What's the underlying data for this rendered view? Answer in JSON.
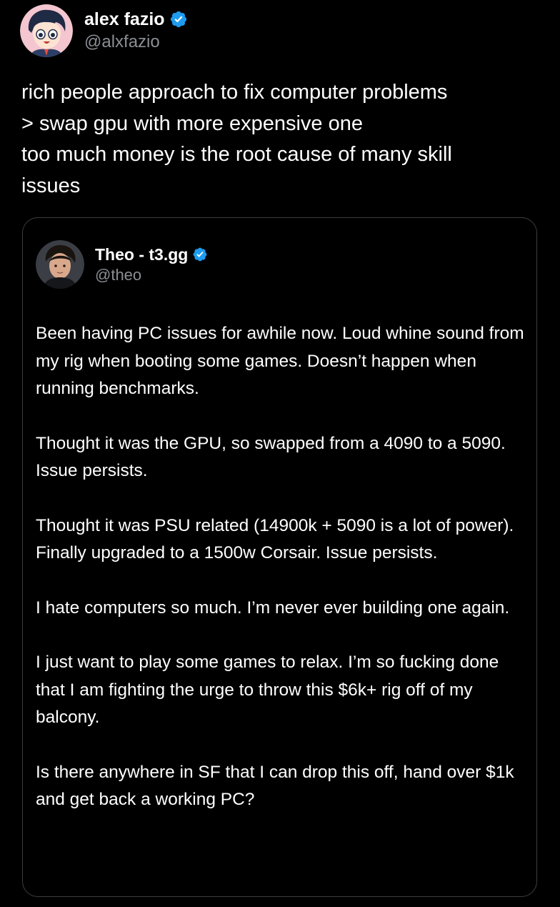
{
  "main_tweet": {
    "author": {
      "display_name": "alex fazio",
      "handle": "@alxfazio",
      "verified": true,
      "avatar_icon": "cartoon-avatar-icon"
    },
    "text": "rich people approach to fix computer problems\n> swap gpu with more expensive one\ntoo much money is the root cause of many skill\nissues"
  },
  "quoted_tweet": {
    "author": {
      "display_name": "Theo - t3.gg",
      "handle": "@theo",
      "verified": true,
      "avatar_icon": "profile-photo-icon"
    },
    "paragraphs": [
      "Been having PC issues for awhile now. Loud whine sound from my rig when booting some games. Doesn’t happen when running benchmarks.",
      "Thought it was the GPU, so swapped from a 4090 to a 5090. Issue persists.",
      "Thought it was PSU related (14900k + 5090 is a lot of power). Finally upgraded to a 1500w Corsair. Issue persists.",
      "I hate computers so much. I’m never ever building one again.",
      "I just want to play some games to relax. I’m so fucking done that I am fighting the urge to throw this $6k+ rig off of my balcony.",
      "Is there anywhere in SF that I can drop this off, hand over $1k and get back a working PC?"
    ]
  },
  "colors": {
    "background": "#000000",
    "text_primary": "#ffffff",
    "text_secondary": "#8b8f94",
    "verified_badge": "#1d9bf0",
    "card_border": "#3a3d41"
  }
}
